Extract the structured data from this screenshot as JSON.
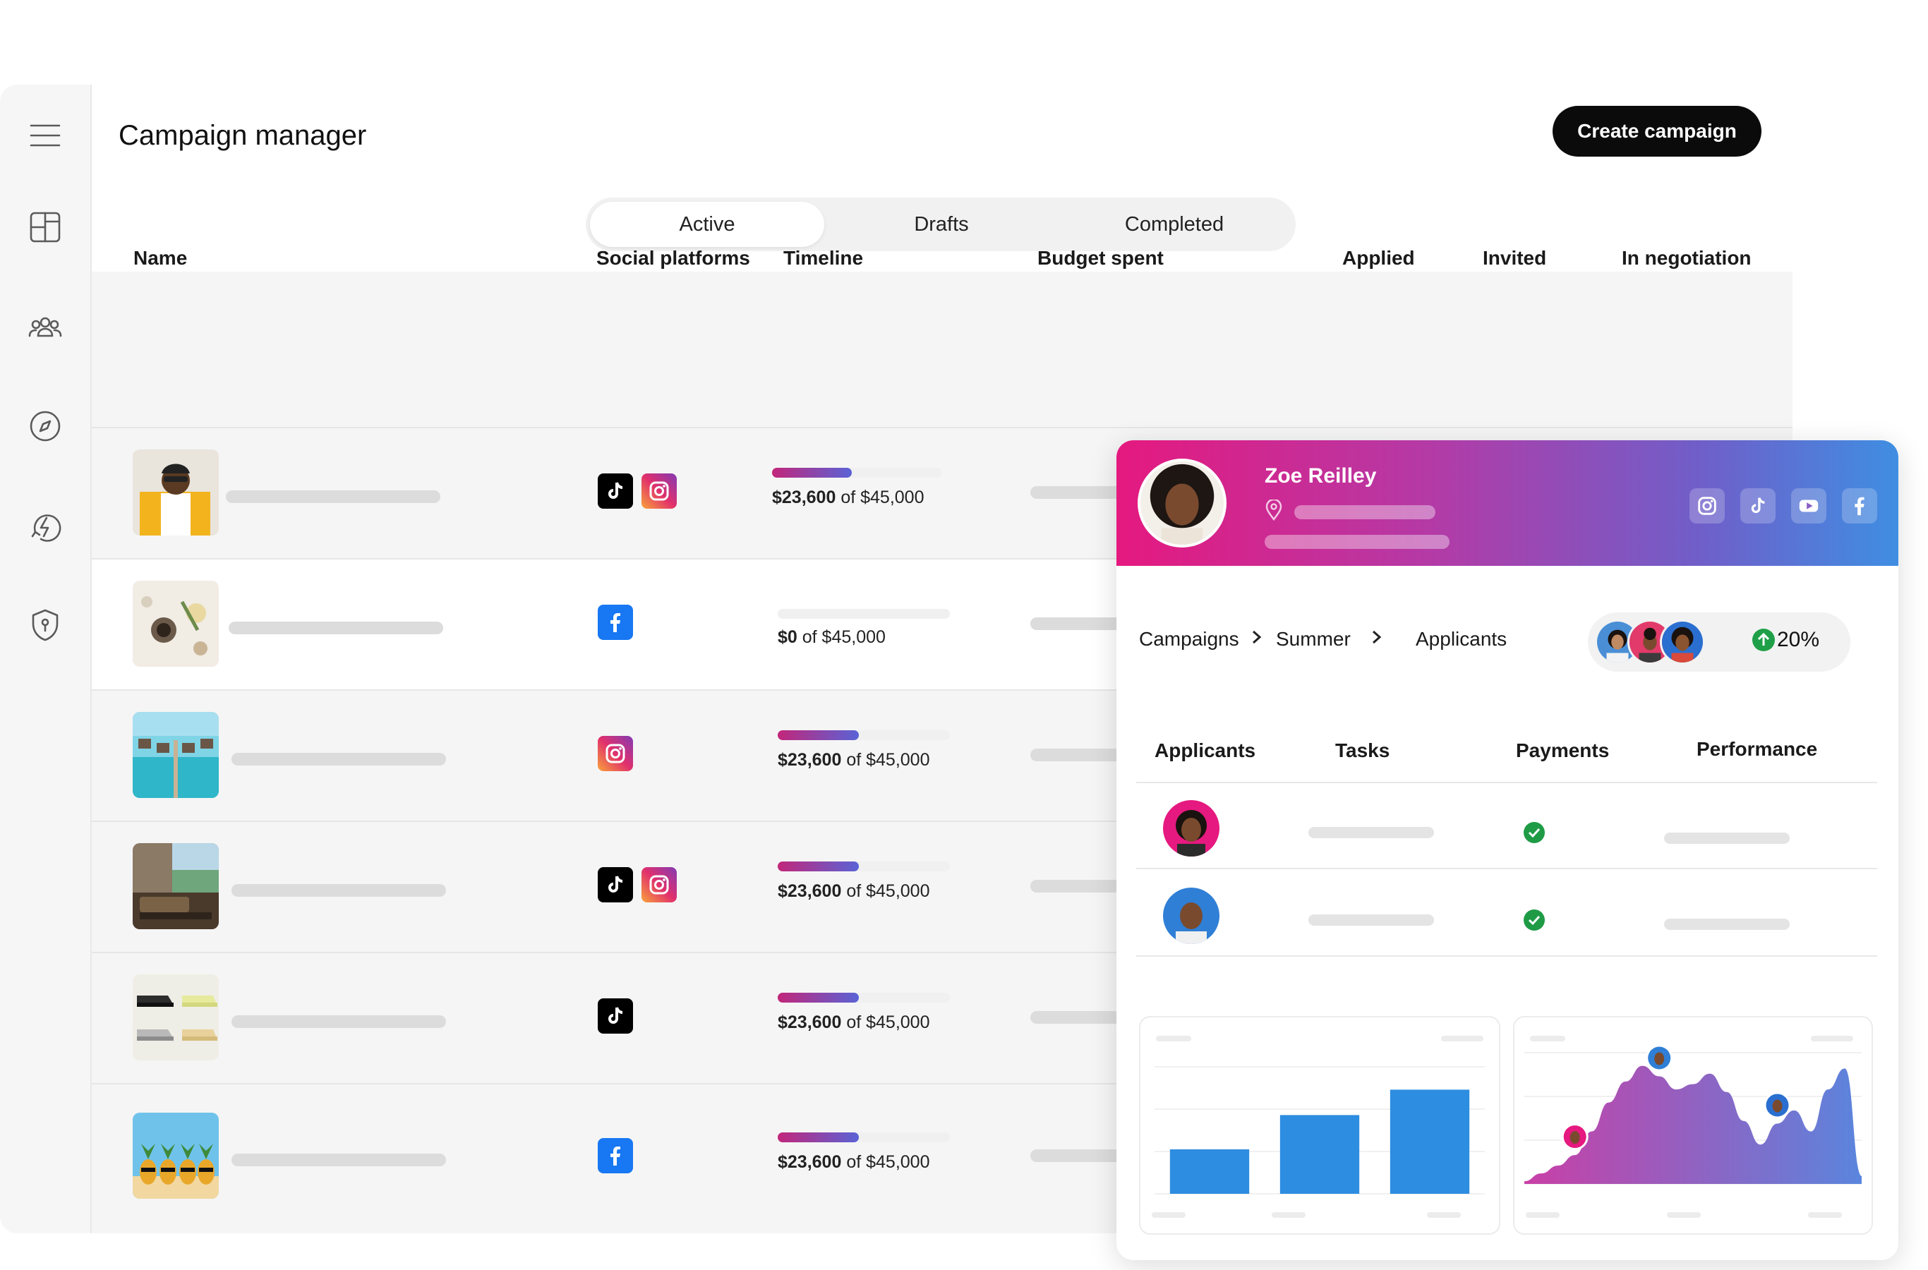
{
  "app": {
    "title": "Campaign manager",
    "create_button": "Create campaign"
  },
  "sidebar": {
    "items": [
      {
        "icon": "menu-icon"
      },
      {
        "icon": "dashboard-icon"
      },
      {
        "icon": "people-icon"
      },
      {
        "icon": "compass-icon"
      },
      {
        "icon": "lightning-icon"
      },
      {
        "icon": "shield-icon"
      }
    ]
  },
  "tabs": [
    {
      "label": "Active",
      "selected": true
    },
    {
      "label": "Drafts",
      "selected": false
    },
    {
      "label": "Completed",
      "selected": false
    }
  ],
  "table": {
    "columns": [
      "Name",
      "Social platforms",
      "Timeline",
      "Budget spent",
      "Applied",
      "Invited",
      "In negotiation"
    ],
    "rows": [
      {
        "thumb": "person-yellow-jacket",
        "platforms": [
          "tiktok",
          "instagram"
        ],
        "spent": "$23,600",
        "budget": "of $45,000",
        "progress": 0.47
      },
      {
        "thumb": "flatlay-food",
        "platforms": [
          "facebook"
        ],
        "spent": "$0",
        "budget": "of $45,000",
        "progress": 0
      },
      {
        "thumb": "overwater-villas",
        "platforms": [
          "instagram"
        ],
        "spent": "$23,600",
        "budget": "of $45,000",
        "progress": 0.47
      },
      {
        "thumb": "hotel-room",
        "platforms": [
          "tiktok",
          "instagram"
        ],
        "spent": "$23,600",
        "budget": "of $45,000",
        "progress": 0.47
      },
      {
        "thumb": "sneakers",
        "platforms": [
          "tiktok"
        ],
        "spent": "$23,600",
        "budget": "of $45,000",
        "progress": 0.47
      },
      {
        "thumb": "pineapples",
        "platforms": [
          "facebook"
        ],
        "spent": "$23,600",
        "budget": "of $45,000",
        "progress": 0.47
      }
    ]
  },
  "profile": {
    "name": "Zoe Reilley",
    "socials": [
      "instagram",
      "tiktok",
      "youtube",
      "facebook"
    ],
    "breadcrumb": [
      "Campaigns",
      "Summer",
      "Applicants"
    ],
    "growth": "20%",
    "sub_columns": [
      "Applicants",
      "Tasks",
      "Payments",
      "Performance"
    ],
    "applicants": [
      {
        "avatar": "woman-avatar",
        "payment_done": true
      },
      {
        "avatar": "man-avatar",
        "payment_done": true
      }
    ]
  },
  "chart_data": [
    {
      "type": "bar",
      "categories": [
        "",
        "",
        ""
      ],
      "values": [
        35,
        62,
        82
      ],
      "ylim": [
        0,
        100
      ],
      "color": "#2d8de0"
    },
    {
      "type": "area",
      "x": [
        0,
        1,
        2,
        3,
        4,
        5,
        6,
        7,
        8,
        9,
        10,
        11,
        12,
        13,
        14,
        15,
        16,
        17,
        18,
        19,
        20
      ],
      "y": [
        2,
        8,
        14,
        22,
        40,
        62,
        78,
        90,
        82,
        72,
        76,
        84,
        70,
        48,
        30,
        46,
        56,
        40,
        72,
        88,
        6
      ],
      "ylim": [
        0,
        100
      ],
      "gradient": [
        "#c93fa6",
        "#5a85dd"
      ]
    }
  ]
}
